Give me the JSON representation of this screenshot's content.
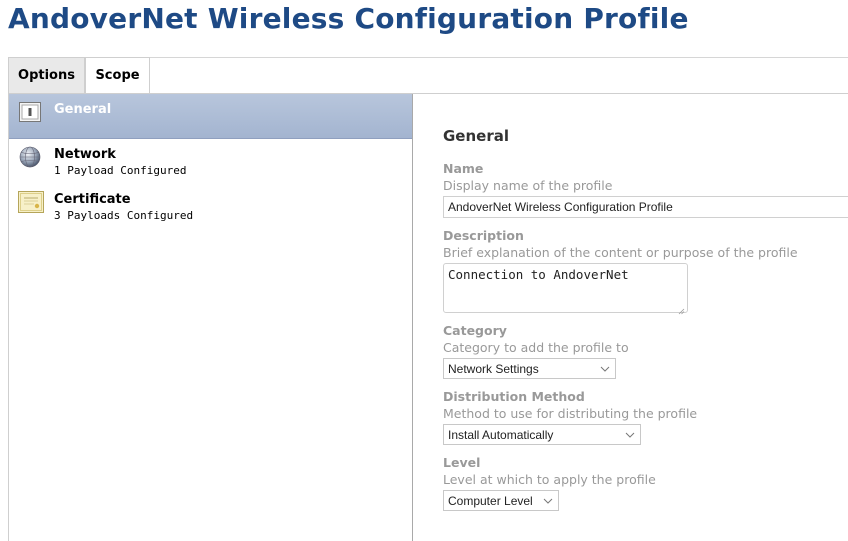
{
  "page": {
    "title": "AndoverNet Wireless Configuration Profile"
  },
  "tabs": [
    {
      "label": "Options"
    },
    {
      "label": "Scope"
    }
  ],
  "sidebar": {
    "items": [
      {
        "name": "General",
        "icon": "general-icon"
      },
      {
        "name": "Network",
        "sub": "1 Payload Configured",
        "icon": "globe-icon"
      },
      {
        "name": "Certificate",
        "sub": "3 Payloads Configured",
        "icon": "certificate-icon"
      }
    ]
  },
  "general": {
    "title": "General",
    "name": {
      "label": "Name",
      "help": "Display name of the profile",
      "value": "AndoverNet Wireless Configuration Profile"
    },
    "description": {
      "label": "Description",
      "help": "Brief explanation of the content or purpose of the profile",
      "value": "Connection to AndoverNet"
    },
    "category": {
      "label": "Category",
      "help": "Category to add the profile to",
      "value": "Network Settings"
    },
    "distribution": {
      "label": "Distribution Method",
      "help": "Method to use for distributing the profile",
      "value": "Install Automatically"
    },
    "level": {
      "label": "Level",
      "help": "Level at which to apply the profile",
      "value": "Computer Level"
    }
  },
  "colors": {
    "title": "#1e4a85",
    "selected_bg": "#a3b4d0",
    "label_gray": "#999999"
  }
}
